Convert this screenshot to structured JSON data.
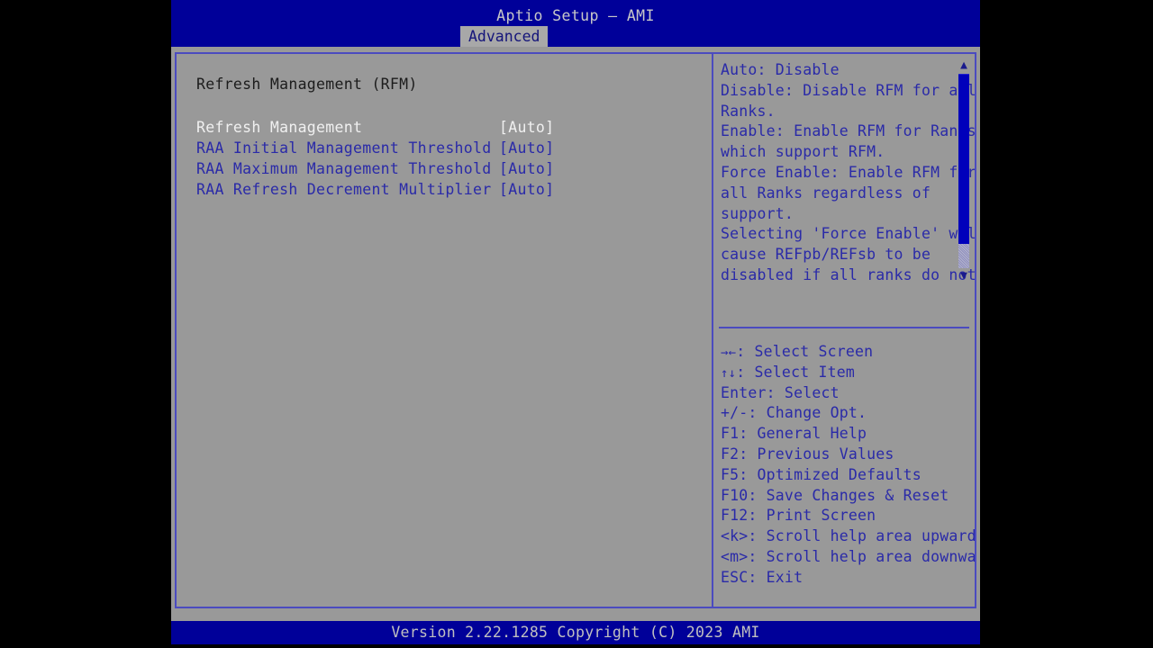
{
  "window": {
    "title": "Aptio Setup – AMI",
    "footer": "Version 2.22.1285 Copyright (C) 2023 AMI"
  },
  "colors": {
    "title_bar_blue": "#000099",
    "panel_gray": "#999999",
    "text_blue": "#2a2aa8",
    "selected_text": "#f0f0f0",
    "border_blue": "#4b4bbf",
    "scroll_thumb": "#0000bb"
  },
  "tabs": [
    {
      "label": "Advanced",
      "active": true
    }
  ],
  "main": {
    "section_heading": "Refresh Management (RFM)",
    "settings": [
      {
        "label": "Refresh Management",
        "value": "[Auto]",
        "selected": true
      },
      {
        "label": "RAA Initial Management Threshold",
        "value": "[Auto]",
        "selected": false
      },
      {
        "label": "RAA Maximum Management Threshold",
        "value": "[Auto]",
        "selected": false
      },
      {
        "label": "RAA Refresh Decrement Multiplier",
        "value": "[Auto]",
        "selected": false
      }
    ]
  },
  "help": {
    "lines": [
      "Auto: Disable",
      "Disable: Disable RFM for all",
      "Ranks.",
      "Enable: Enable RFM for Ranks",
      "which support RFM.",
      "Force Enable: Enable RFM for",
      "all Ranks regardless of",
      "support.",
      "Selecting 'Force Enable' will",
      "cause REFpb/REFsb to be",
      "disabled if all ranks do not"
    ],
    "scroll_up_glyph": "▲",
    "scroll_down_glyph": "▼"
  },
  "key_legend": [
    {
      "glyph": "→←",
      "text": ": Select Screen"
    },
    {
      "glyph": "↑↓",
      "text": ": Select Item"
    },
    {
      "glyph": "",
      "text": "Enter: Select"
    },
    {
      "glyph": "",
      "text": "+/-: Change Opt."
    },
    {
      "glyph": "",
      "text": "F1: General Help"
    },
    {
      "glyph": "",
      "text": "F2: Previous Values"
    },
    {
      "glyph": "",
      "text": "F5: Optimized Defaults"
    },
    {
      "glyph": "",
      "text": "F10: Save Changes & Reset"
    },
    {
      "glyph": "",
      "text": "F12: Print Screen"
    },
    {
      "glyph": "",
      "text": "<k>: Scroll help area upwards"
    },
    {
      "glyph": "",
      "text": "<m>: Scroll help area downwards"
    },
    {
      "glyph": "",
      "text": "ESC: Exit"
    }
  ]
}
